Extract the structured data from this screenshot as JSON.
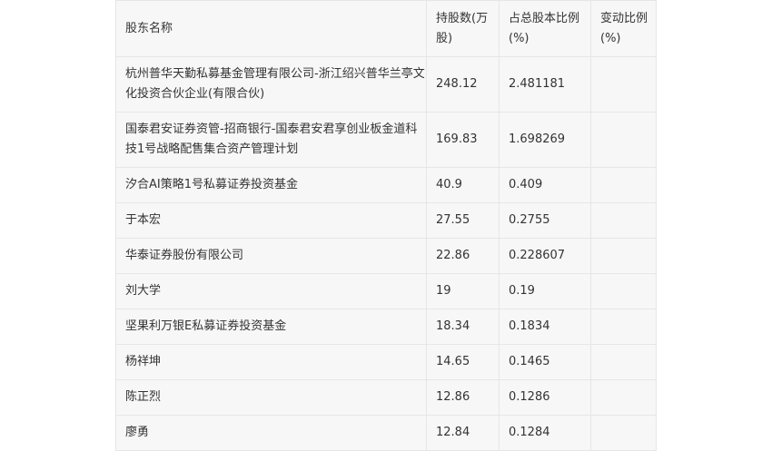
{
  "table": {
    "headers": [
      "股东名称",
      "持股数(万股)",
      "占总股本比例(%)",
      "变动比例(%)"
    ],
    "rows": [
      {
        "name": "杭州普华天勤私募基金管理有限公司-浙江绍兴普华兰亭文化投资合伙企业(有限合伙)",
        "shares": "248.12",
        "ratio": "2.481181",
        "change": ""
      },
      {
        "name": "国泰君安证券资管-招商银行-国泰君安君享创业板金道科技1号战略配售集合资产管理计划",
        "shares": "169.83",
        "ratio": "1.698269",
        "change": ""
      },
      {
        "name": "汐合AI策略1号私募证券投资基金",
        "shares": "40.9",
        "ratio": "0.409",
        "change": ""
      },
      {
        "name": "于本宏",
        "shares": "27.55",
        "ratio": "0.2755",
        "change": ""
      },
      {
        "name": "华泰证券股份有限公司",
        "shares": "22.86",
        "ratio": "0.228607",
        "change": ""
      },
      {
        "name": "刘大学",
        "shares": "19",
        "ratio": "0.19",
        "change": ""
      },
      {
        "name": "坚果利万银E私募证券投资基金",
        "shares": "18.34",
        "ratio": "0.1834",
        "change": ""
      },
      {
        "name": "杨祥坤",
        "shares": "14.65",
        "ratio": "0.1465",
        "change": ""
      },
      {
        "name": "陈正烈",
        "shares": "12.86",
        "ratio": "0.1286",
        "change": ""
      },
      {
        "name": "廖勇",
        "shares": "12.84",
        "ratio": "0.1284",
        "change": ""
      }
    ]
  }
}
